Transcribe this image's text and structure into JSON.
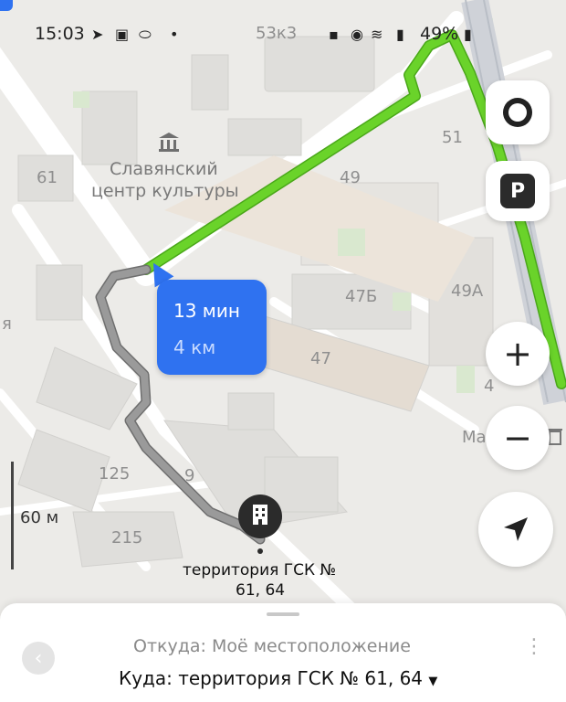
{
  "status_bar": {
    "time": "15:03",
    "battery": "49%"
  },
  "map": {
    "building_labels": [
      "53к3",
      "61",
      "49",
      "51",
      "47Б",
      "49А",
      "47",
      "125",
      "9",
      "215",
      "я",
      "4",
      "Ма"
    ],
    "poi_label_line1": "Славянский",
    "poi_label_line2": "центр культуры",
    "scale_label": "60 м",
    "destination_label_line1": "территория ГСК №",
    "destination_label_line2": "61, 64",
    "colors": {
      "route_traffic": "#6ad32a",
      "route_walk": "#8a8a8a",
      "bubble": "#2f72f0"
    }
  },
  "route_bubble": {
    "time": "13 мин",
    "distance": "4 км"
  },
  "controls": {
    "alice_icon": "alice-icon",
    "parking_label": "P",
    "zoom_in": "+",
    "zoom_out": "−",
    "locate_icon": "navigation-arrow-icon"
  },
  "bottom_panel": {
    "from": "Откуда: Моё местоположение",
    "to": "Куда: территория ГСК № 61, 64"
  }
}
